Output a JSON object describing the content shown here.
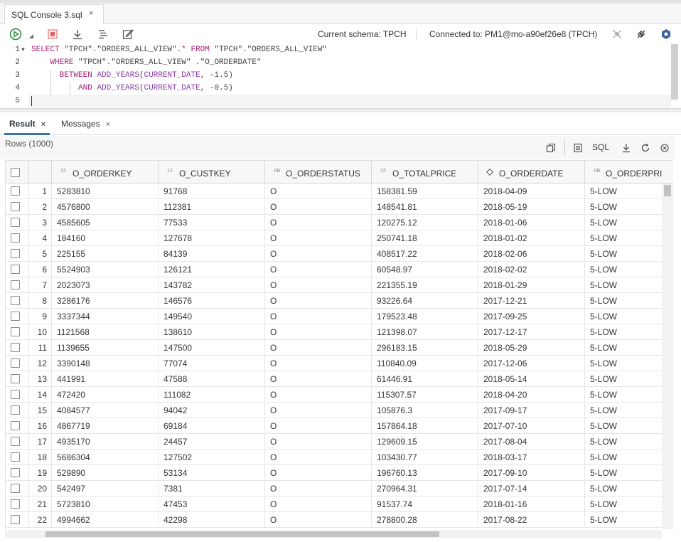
{
  "file_tab": {
    "title": "SQL Console 3.sql",
    "close": "×"
  },
  "toolbar": {
    "current_schema": "Current schema: TPCH",
    "connected_to": "Connected to: PM1@mo-a90ef26e8 (TPCH)"
  },
  "editor": {
    "line_numbers": [
      "1",
      "2",
      "3",
      "4",
      "5"
    ],
    "lines": [
      [
        [
          "kw",
          "SELECT"
        ],
        [
          "str",
          " \"TPCH\".\"ORDERS_ALL_VIEW\"."
        ],
        [
          "kw",
          "*"
        ],
        [
          "str",
          " "
        ],
        [
          "kw",
          "FROM"
        ],
        [
          "str",
          " \"TPCH\".\"ORDERS_ALL_VIEW\""
        ]
      ],
      [
        [
          "str",
          "    "
        ],
        [
          "kw",
          "WHERE"
        ],
        [
          "str",
          " \"TPCH\".\"ORDERS_ALL_VIEW\" .\"O_ORDERDATE\""
        ]
      ],
      [
        [
          "str",
          "      "
        ],
        [
          "kw",
          "BETWEEN"
        ],
        [
          "str",
          " "
        ],
        [
          "fn",
          "ADD_YEARS"
        ],
        [
          "str",
          "("
        ],
        [
          "fn",
          "CURRENT_DATE"
        ],
        [
          "str",
          ", -1.5)"
        ]
      ],
      [
        [
          "str",
          "          "
        ],
        [
          "kw",
          "AND"
        ],
        [
          "str",
          " "
        ],
        [
          "fn",
          "ADD_YEARS"
        ],
        [
          "str",
          "("
        ],
        [
          "fn",
          "CURRENT_DATE"
        ],
        [
          "str",
          ", -0.5)"
        ]
      ],
      []
    ]
  },
  "result_tabs": [
    {
      "label": "Result",
      "close": "×",
      "active": true
    },
    {
      "label": "Messages",
      "close": "×",
      "active": false
    }
  ],
  "grid": {
    "rows_label": "Rows (1000)",
    "sql_label": "SQL",
    "columns": [
      {
        "name": "O_ORDERKEY",
        "type_badge": "12"
      },
      {
        "name": "O_CUSTKEY",
        "type_badge": "12"
      },
      {
        "name": "O_ORDERSTATUS",
        "type_badge": "AB"
      },
      {
        "name": "O_TOTALPRICE",
        "type_badge": "12"
      },
      {
        "name": "O_ORDERDATE",
        "type_badge": "date"
      },
      {
        "name": "O_ORDERPRI",
        "type_badge": "AB"
      }
    ],
    "rows": [
      [
        "1",
        "5283810",
        "91768",
        "O",
        "158381.59",
        "2018-04-09",
        "5-LOW"
      ],
      [
        "2",
        "4576800",
        "112381",
        "O",
        "148541.81",
        "2018-05-19",
        "5-LOW"
      ],
      [
        "3",
        "4585605",
        "77533",
        "O",
        "120275.12",
        "2018-01-06",
        "5-LOW"
      ],
      [
        "4",
        "184160",
        "127678",
        "O",
        "250741.18",
        "2018-01-02",
        "5-LOW"
      ],
      [
        "5",
        "225155",
        "84139",
        "O",
        "408517.22",
        "2018-02-06",
        "5-LOW"
      ],
      [
        "6",
        "5524903",
        "126121",
        "O",
        "60548.97",
        "2018-02-02",
        "5-LOW"
      ],
      [
        "7",
        "2023073",
        "143782",
        "O",
        "221355.19",
        "2018-01-29",
        "5-LOW"
      ],
      [
        "8",
        "3286176",
        "146576",
        "O",
        "93226.64",
        "2017-12-21",
        "5-LOW"
      ],
      [
        "9",
        "3337344",
        "149540",
        "O",
        "179523.48",
        "2017-09-25",
        "5-LOW"
      ],
      [
        "10",
        "1121568",
        "138610",
        "O",
        "121398.07",
        "2017-12-17",
        "5-LOW"
      ],
      [
        "11",
        "1139655",
        "147500",
        "O",
        "296183.15",
        "2018-05-29",
        "5-LOW"
      ],
      [
        "12",
        "3390148",
        "77074",
        "O",
        "110840.09",
        "2017-12-06",
        "5-LOW"
      ],
      [
        "13",
        "441991",
        "47588",
        "O",
        "61446.91",
        "2018-05-14",
        "5-LOW"
      ],
      [
        "14",
        "472420",
        "111082",
        "O",
        "115307.57",
        "2018-04-20",
        "5-LOW"
      ],
      [
        "15",
        "4084577",
        "94042",
        "O",
        "105876.3",
        "2017-09-17",
        "5-LOW"
      ],
      [
        "16",
        "4867719",
        "69184",
        "O",
        "157864.18",
        "2017-07-10",
        "5-LOW"
      ],
      [
        "17",
        "4935170",
        "24457",
        "O",
        "129609.15",
        "2017-08-04",
        "5-LOW"
      ],
      [
        "18",
        "5686304",
        "127502",
        "O",
        "103430.77",
        "2018-03-17",
        "5-LOW"
      ],
      [
        "19",
        "529890",
        "53134",
        "O",
        "196760.13",
        "2017-09-10",
        "5-LOW"
      ],
      [
        "20",
        "542497",
        "7381",
        "O",
        "270964.31",
        "2017-07-14",
        "5-LOW"
      ],
      [
        "21",
        "5723810",
        "47453",
        "O",
        "91537.74",
        "2018-01-16",
        "5-LOW"
      ],
      [
        "22",
        "4994662",
        "42298",
        "O",
        "278800.28",
        "2017-08-22",
        "5-LOW"
      ]
    ]
  },
  "icons": {
    "run": "run-icon",
    "stop": "stop-icon",
    "download": "download-icon",
    "format": "format-icon",
    "edit": "edit-icon",
    "disconnect": "disconnect-icon",
    "connect": "change-connection-icon",
    "settings": "hexagon-settings-icon"
  },
  "colors": {
    "run_green": "#2b8a3e",
    "stop_red": "#e06666",
    "keyword": "#a7247c",
    "function": "#8a3ea4",
    "accent": "#3b6fb6"
  }
}
